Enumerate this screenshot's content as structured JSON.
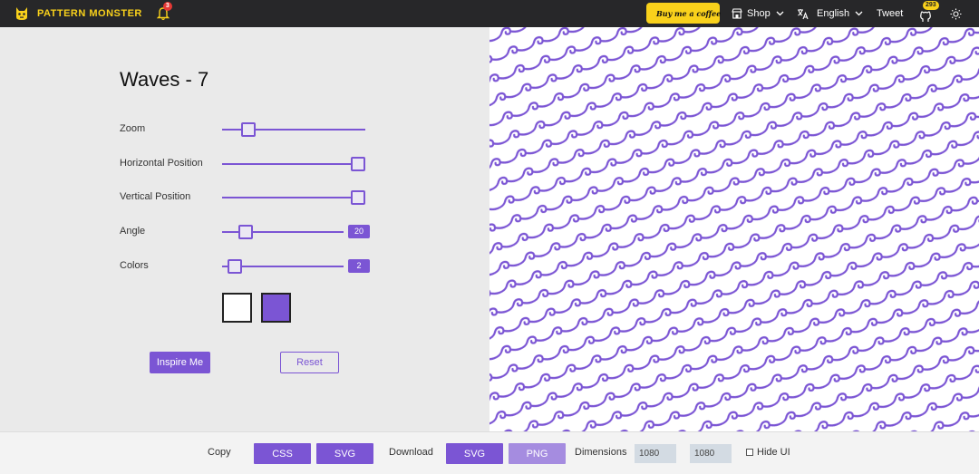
{
  "header": {
    "logo_text": "PATTERN MONSTER",
    "notification_count": "3",
    "coffee_label": "Buy me a coffee",
    "shop_label": "Shop",
    "language_label": "English",
    "tweet_label": "Tweet",
    "github_count": "293"
  },
  "pattern": {
    "title": "Waves - 7",
    "controls": {
      "zoom_label": "Zoom",
      "zoom_value": 0.15,
      "hpos_label": "Horizontal Position",
      "hpos_value": 1.0,
      "vpos_label": "Vertical Position",
      "vpos_value": 1.0,
      "angle_label": "Angle",
      "angle_value": "20",
      "angle_fraction": 0.15,
      "colors_label": "Colors",
      "colors_value": "2",
      "colors_fraction": 0.05
    },
    "swatches": [
      "#ffffff",
      "#7b55d4"
    ],
    "inspire_label": "Inspire Me",
    "reset_label": "Reset"
  },
  "colors": {
    "accent": "#7b55d4",
    "header_bg": "#272729",
    "brand_yellow": "#f9d11b"
  },
  "bottom": {
    "copy_label": "Copy",
    "css_label": "CSS",
    "svg_copy_label": "SVG",
    "download_label": "Download",
    "svg_download_label": "SVG",
    "png_label": "PNG",
    "dimensions_label": "Dimensions",
    "width_value": "1080",
    "height_value": "1080",
    "hide_ui_label": "Hide UI"
  }
}
